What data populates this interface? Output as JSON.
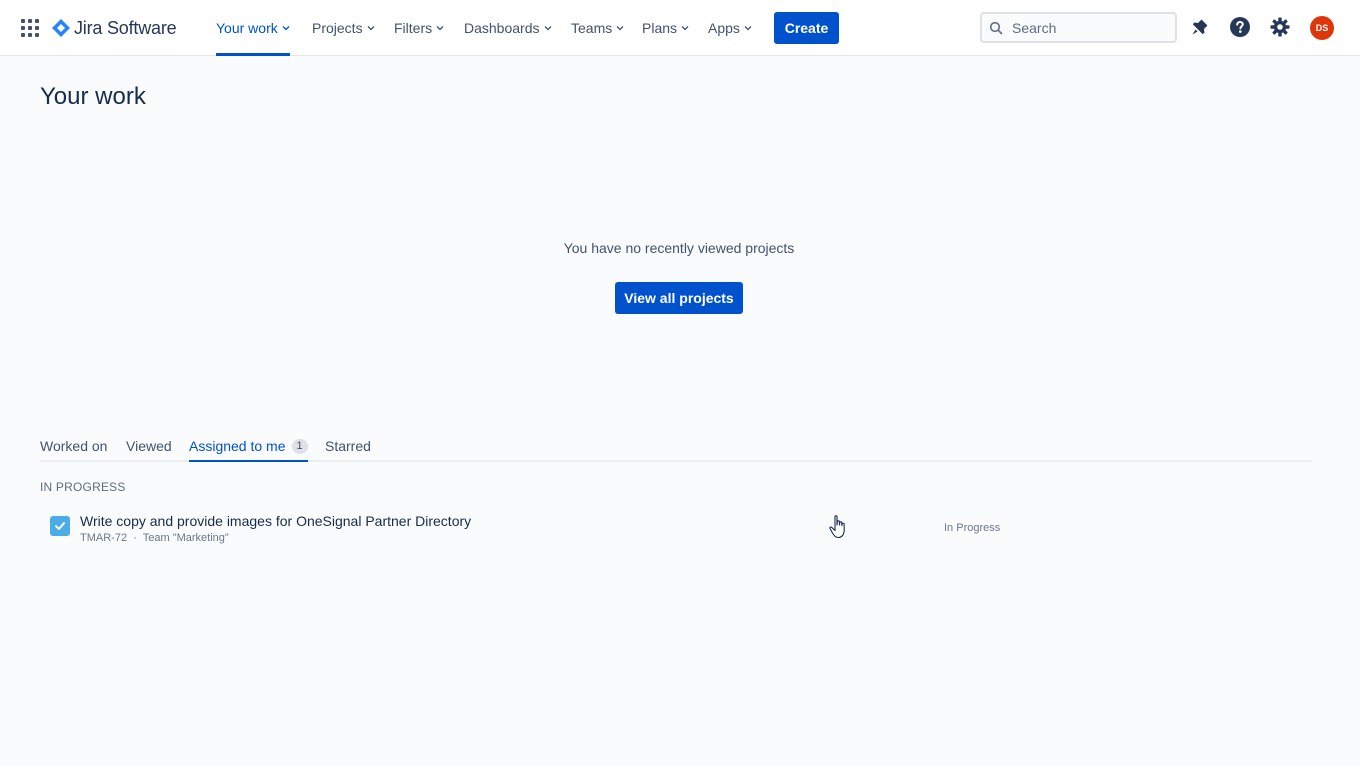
{
  "nav": {
    "product_name": "Jira Software",
    "items": [
      {
        "label": "Your work",
        "active": true
      },
      {
        "label": "Projects",
        "active": false
      },
      {
        "label": "Filters",
        "active": false
      },
      {
        "label": "Dashboards",
        "active": false
      },
      {
        "label": "Teams",
        "active": false
      },
      {
        "label": "Plans",
        "active": false
      },
      {
        "label": "Apps",
        "active": false
      }
    ],
    "create_label": "Create",
    "search_placeholder": "Search",
    "user_initials": "DS",
    "icons": [
      "app-switcher-icon",
      "notifications-icon",
      "help-icon",
      "settings-icon"
    ]
  },
  "page": {
    "title": "Your work",
    "empty_projects_message": "You have no recently viewed projects",
    "view_all_projects_label": "View all projects"
  },
  "tabs": [
    {
      "label": "Worked on",
      "active": false
    },
    {
      "label": "Viewed",
      "active": false
    },
    {
      "label": "Assigned to me",
      "active": true,
      "count": "1"
    },
    {
      "label": "Starred",
      "active": false
    }
  ],
  "sections": [
    {
      "label": "IN PROGRESS",
      "issues": [
        {
          "title": "Write copy and provide images for OneSignal Partner Directory",
          "key": "TMAR-72",
          "team": "Team \"Marketing\"",
          "status": "In Progress",
          "type_icon": "task-icon"
        }
      ]
    }
  ],
  "colors": {
    "primary": "#0052cc",
    "avatar": "#de350b",
    "task_icon": "#4bade8"
  }
}
